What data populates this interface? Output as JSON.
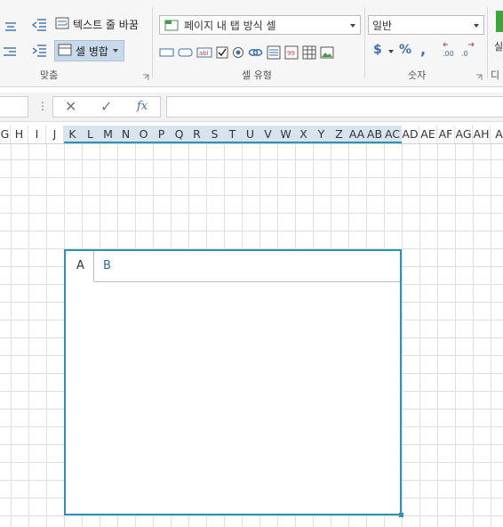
{
  "ribbon": {
    "alignment": {
      "wrap_text_label": "텍스트 줄 바꿈",
      "merge_cells_label": "셀 병합",
      "group_label": "맞춤"
    },
    "cell_type": {
      "selected_type": "페이지 내 탭 방식 셀",
      "group_label": "셀 유형",
      "icons": [
        "textbox-icon",
        "button-icon",
        "label-icon",
        "checkbox-icon",
        "radio-icon",
        "hyperlink-icon",
        "list-icon",
        "number-icon",
        "table-icon",
        "image-icon"
      ]
    },
    "number": {
      "format_value": "일반",
      "currency_symbol": "$",
      "percent_symbol": "%",
      "comma_symbol": ",",
      "increase_decimal": ".00",
      "decrease_decimal": ".0",
      "group_label": "숫자"
    },
    "partial_right": {
      "label_top": "실",
      "label_bottom": "디",
      "accent_color": "#3aa637"
    }
  },
  "formula_bar": {
    "name_box_value": "",
    "cancel_symbol": "✕",
    "enter_symbol": "✓",
    "function_symbol": "fx",
    "formula_value": ""
  },
  "columns": [
    "G",
    "H",
    "I",
    "J",
    "K",
    "L",
    "M",
    "N",
    "O",
    "P",
    "Q",
    "R",
    "S",
    "T",
    "U",
    "V",
    "W",
    "X",
    "Y",
    "Z",
    "AA",
    "AB",
    "AC",
    "AD",
    "AE",
    "AF",
    "AG",
    "AH",
    "A"
  ],
  "selected_columns_range": "K:AC",
  "tab_control": {
    "tabs": [
      {
        "label": "A",
        "active": true
      },
      {
        "label": "B",
        "active": false
      }
    ],
    "border_color": "#2b93b4"
  }
}
